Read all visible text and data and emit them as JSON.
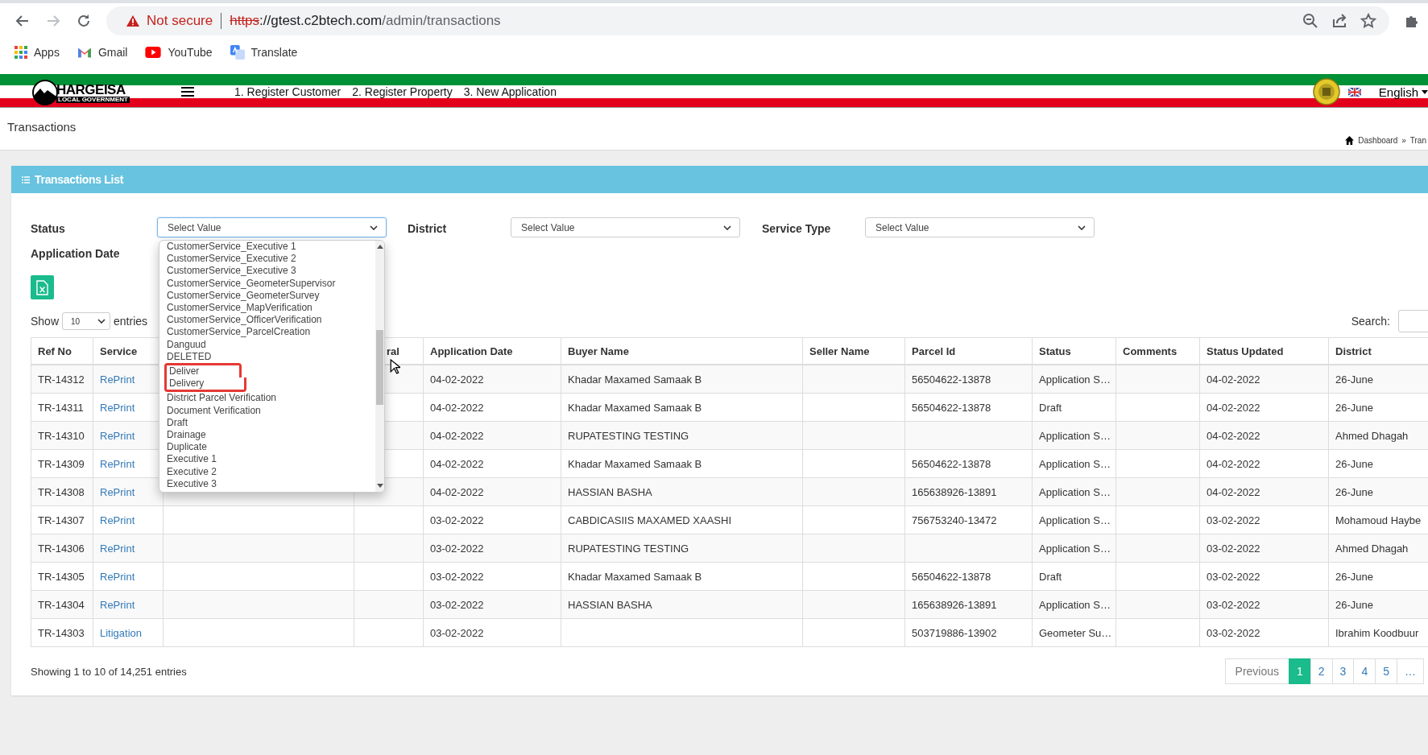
{
  "browser": {
    "security": "Not secure",
    "url": {
      "scheme": "https",
      "host": "://gtest.c2btech.com",
      "path": "/admin/transactions"
    },
    "bookmarks": [
      {
        "kind": "apps",
        "label": "Apps"
      },
      {
        "kind": "gmail",
        "label": "Gmail"
      },
      {
        "kind": "youtube",
        "label": "YouTube"
      },
      {
        "kind": "translate",
        "label": "Translate"
      }
    ]
  },
  "header": {
    "logo_title": "HARGEISA",
    "logo_subtitle": "LOCAL GOVERNMENT",
    "nav": [
      "1. Register Customer",
      "2. Register Property",
      "3. New Application"
    ],
    "language": "English"
  },
  "page_title": "Transactions",
  "breadcrumb": [
    "Dashboard",
    "»",
    "Tran"
  ],
  "card": {
    "title": "Transactions List",
    "filters": [
      {
        "label": "Status",
        "placeholder": "Select Value",
        "open": true
      },
      {
        "label": "District",
        "placeholder": "Select Value",
        "open": false
      },
      {
        "label": "Service Type",
        "placeholder": "Select Value",
        "open": false
      }
    ],
    "date_filter": {
      "label": "Application Date"
    },
    "status_options": [
      {
        "label": "CustomerService_Executive 1",
        "highlighted": false
      },
      {
        "label": "CustomerService_Executive 2",
        "highlighted": false
      },
      {
        "label": "CustomerService_Executive 3",
        "highlighted": false
      },
      {
        "label": "CustomerService_GeometerSupervisor",
        "highlighted": false
      },
      {
        "label": "CustomerService_GeometerSurvey",
        "highlighted": false
      },
      {
        "label": "CustomerService_MapVerification",
        "highlighted": false
      },
      {
        "label": "CustomerService_OfficerVerification",
        "highlighted": false
      },
      {
        "label": "CustomerService_ParcelCreation",
        "highlighted": false
      },
      {
        "label": "Danguud",
        "highlighted": false
      },
      {
        "label": "DELETED",
        "highlighted": false
      },
      {
        "label": "Deliver",
        "highlighted": true
      },
      {
        "label": "Delivery",
        "highlighted": true
      },
      {
        "label": "District Parcel Verification",
        "highlighted": false
      },
      {
        "label": "Document Verification",
        "highlighted": false
      },
      {
        "label": "Draft",
        "highlighted": false
      },
      {
        "label": "Drainage",
        "highlighted": false
      },
      {
        "label": "Duplicate",
        "highlighted": false
      },
      {
        "label": "Executive 1",
        "highlighted": false
      },
      {
        "label": "Executive 2",
        "highlighted": false
      },
      {
        "label": "Executive 3",
        "highlighted": false
      }
    ],
    "show_label": "Show",
    "page_size": "10",
    "entries_label": "entries",
    "search_label": "Search:",
    "columns": [
      {
        "label": "Ref No"
      },
      {
        "label": "Service",
        "kind": "link"
      },
      {},
      {
        "label": "ral"
      },
      {
        "label": "Application Date"
      },
      {
        "label": "Buyer Name"
      },
      {
        "label": "Seller Name"
      },
      {
        "label": "Parcel Id"
      },
      {
        "label": "Status"
      },
      {
        "label": "Comments"
      },
      {
        "label": "Status Updated"
      },
      {
        "label": "District"
      }
    ],
    "rows": [
      {
        "ref_no": "TR-14312",
        "service": "RePrint",
        "application_date": "04-02-2022",
        "buyer_name": "Khadar Maxamed Samaak B",
        "parcel_id": "56504622-13878",
        "status": "Application S…",
        "status_updated": "04-02-2022",
        "district": "26-June"
      },
      {
        "ref_no": "TR-14311",
        "service": "RePrint",
        "application_date": "04-02-2022",
        "buyer_name": "Khadar Maxamed Samaak B",
        "parcel_id": "56504622-13878",
        "status": "Draft",
        "status_updated": "04-02-2022",
        "district": "26-June"
      },
      {
        "ref_no": "TR-14310",
        "service": "RePrint",
        "application_date": "04-02-2022",
        "buyer_name": "RUPATESTING TESTING",
        "status": "Application S…",
        "status_updated": "04-02-2022",
        "district": "Ahmed Dhagah"
      },
      {
        "ref_no": "TR-14309",
        "service": "RePrint",
        "application_date": "04-02-2022",
        "buyer_name": "Khadar Maxamed Samaak B",
        "parcel_id": "56504622-13878",
        "status": "Application S…",
        "status_updated": "04-02-2022",
        "district": "26-June"
      },
      {
        "ref_no": "TR-14308",
        "service": "RePrint",
        "application_date": "04-02-2022",
        "buyer_name": "HASSIAN BASHA",
        "parcel_id": "165638926-13891",
        "status": "Application S…",
        "status_updated": "04-02-2022",
        "district": "26-June"
      },
      {
        "ref_no": "TR-14307",
        "service": "RePrint",
        "application_date": "03-02-2022",
        "buyer_name": "CABDICASIIS MAXAMED XAASHI",
        "parcel_id": "756753240-13472",
        "status": "Application S…",
        "status_updated": "03-02-2022",
        "district": "Mohamoud Haybe"
      },
      {
        "ref_no": "TR-14306",
        "service": "RePrint",
        "application_date": "03-02-2022",
        "buyer_name": "RUPATESTING TESTING",
        "status": "Application S…",
        "status_updated": "03-02-2022",
        "district": "Ahmed Dhagah"
      },
      {
        "ref_no": "TR-14305",
        "service": "RePrint",
        "application_date": "03-02-2022",
        "buyer_name": "Khadar Maxamed Samaak B",
        "parcel_id": "56504622-13878",
        "status": "Draft",
        "status_updated": "03-02-2022",
        "district": "26-June"
      },
      {
        "ref_no": "TR-14304",
        "service": "RePrint",
        "application_date": "03-02-2022",
        "buyer_name": "HASSIAN BASHA",
        "parcel_id": "165638926-13891",
        "status": "Application S…",
        "status_updated": "03-02-2022",
        "district": "26-June"
      },
      {
        "ref_no": "TR-14303",
        "service": "Litigation",
        "application_date": "03-02-2022",
        "parcel_id": "503719886-13902",
        "status": "Geometer Su…",
        "status_updated": "03-02-2022",
        "district": "Ibrahim Koodbuur"
      }
    ],
    "summary": "Showing 1 to 10 of 14,251 entries",
    "pagination": [
      {
        "label": "Previous",
        "selected": false
      },
      {
        "label": "1",
        "selected": true
      },
      {
        "label": "2",
        "selected": false
      },
      {
        "label": "3",
        "selected": false
      },
      {
        "label": "4",
        "selected": false
      },
      {
        "label": "5",
        "selected": false
      },
      {
        "label": "…",
        "selected": false
      }
    ]
  }
}
